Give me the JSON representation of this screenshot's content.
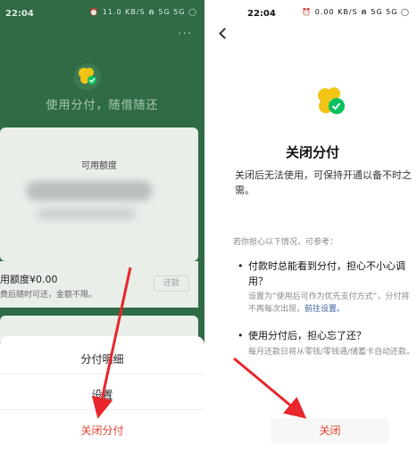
{
  "colors": {
    "brand_green": "#2f6b44",
    "danger_red": "#e0422f",
    "arrow_red": "#e8262c"
  },
  "left": {
    "status_bar": {
      "time": "22:04",
      "icons": "⏰ 11.0 KB/S ⋒ 5G 5G ◯"
    },
    "more_icon": "···",
    "slogan": "使用分付，随借随还",
    "card": {
      "label": "可用额度"
    },
    "quota": {
      "line1": "用额度¥0.00",
      "line2": "费后随时可还，金额不限。",
      "button": "还款"
    },
    "sheet": {
      "item1": "分付明细",
      "item2": "设置",
      "item3": "关闭分付"
    }
  },
  "right": {
    "status_bar": {
      "time": "22:04",
      "icons": "⏰ 0.00 KB/S ⋒ 5G 5G ◯"
    },
    "title": "关闭分付",
    "desc": "关闭后无法使用，可保持开通以备不时之需。",
    "ref": "若你担心以下情况，可参考：",
    "q1": "付款时总能看到分付，担心不小心调用？",
    "a1": "设置为“使用后可作为优先支付方式”，分付将不再每次出现，",
    "a1_link": "前往设置。",
    "q2": "使用分付后，担心忘了还？",
    "a2": "每月还款日将从零钱/零钱通/储蓄卡自动还款。",
    "close_button": "关闭"
  }
}
